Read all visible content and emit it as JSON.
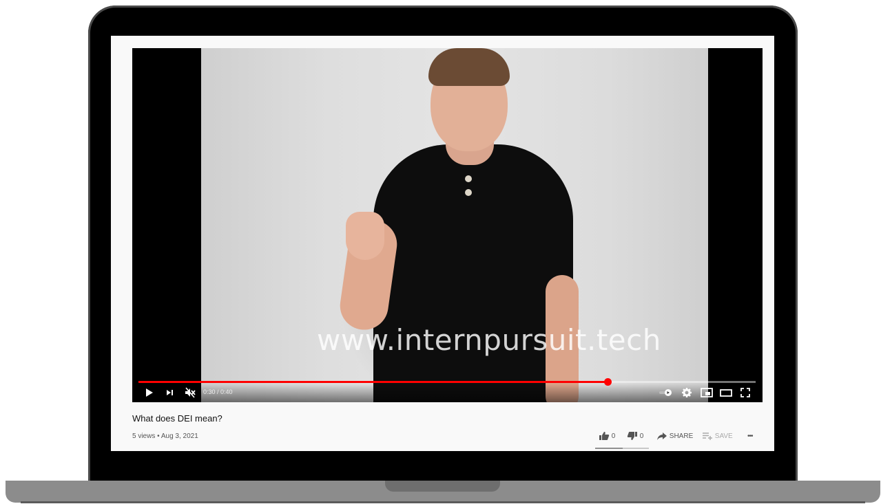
{
  "video": {
    "watermark": "www.internpursuit.tech",
    "time_display": "0:30 / 0:40",
    "progress": 0.76,
    "title": "What does DEI mean?",
    "meta": "5 views • Aug 3, 2021"
  },
  "controls": {
    "icons": [
      "play-icon",
      "next-icon",
      "mute-icon",
      "autoplay-toggle-icon",
      "settings-icon",
      "miniplayer-icon",
      "theater-icon",
      "fullscreen-icon"
    ],
    "accent": "#ff0000"
  },
  "actions": {
    "like_count": "0",
    "dislike_count": "0",
    "share_label": "SHARE",
    "save_label": "SAVE",
    "more_label": "•••"
  }
}
